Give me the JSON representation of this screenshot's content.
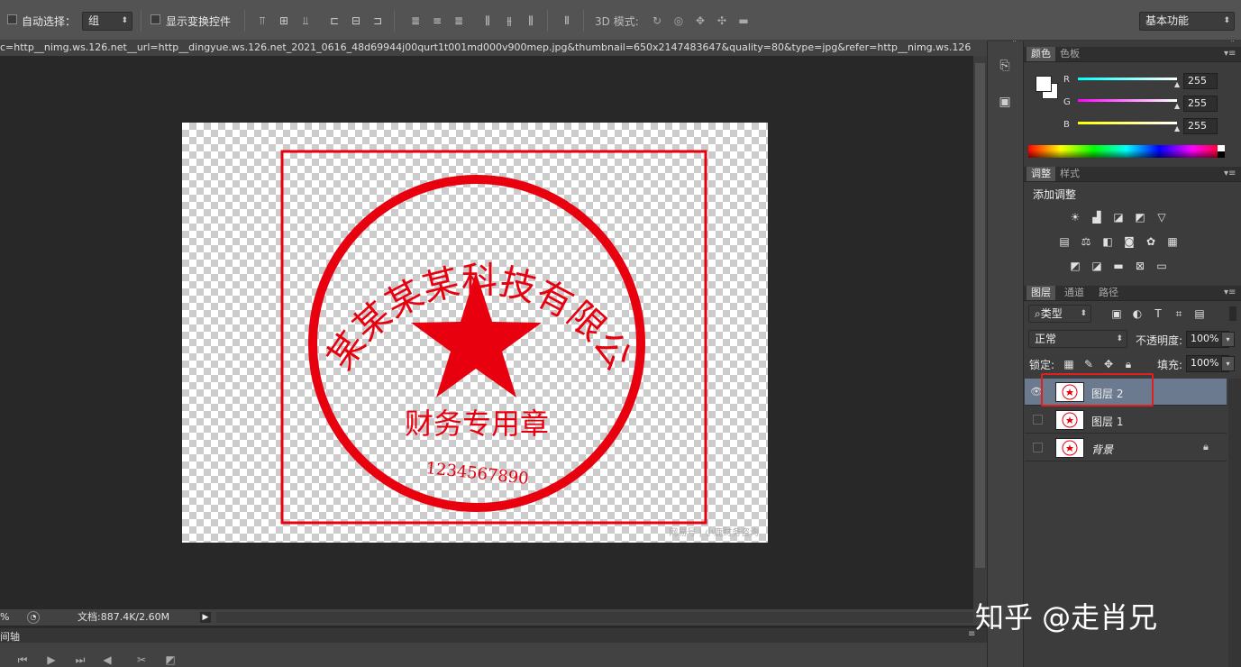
{
  "options_bar": {
    "auto_select_label": "自动选择：",
    "auto_select_value": "组",
    "show_transform_label": "显示变换控件",
    "mode_3d_label": "3D 模式:",
    "workspace_value": "基本功能"
  },
  "document": {
    "tab_title": "c=http__nimg.ws.126.net__url=http__dingyue.ws.126.net_2021_0616_48d69944j00qurt1t001md000v900mep.jpg&thumbnail=650x2147483647&quality=80&type=jpg&refer=http__nimg.ws.126",
    "stamp_arc_text": "某某某某某科技有限公司",
    "stamp_purpose_text": "财务专用章",
    "stamp_number_text": "1234567890",
    "image_watermark": "网易号 | 小鹿财务咨询"
  },
  "status_bar": {
    "zoom": "%",
    "doc_size": "文档:887.4K/2.60M"
  },
  "timeline": {
    "title": "间轴"
  },
  "color_panel": {
    "tabs": [
      "颜色",
      "色板"
    ],
    "r_label": "R",
    "g_label": "G",
    "b_label": "B",
    "r_value": "255",
    "g_value": "255",
    "b_value": "255"
  },
  "adjust_panel": {
    "tabs": [
      "调整",
      "样式"
    ],
    "title": "添加调整"
  },
  "layers_panel": {
    "tabs": [
      "图层",
      "通道",
      "路径"
    ],
    "filter_kind": "类型",
    "blend_mode": "正常",
    "opacity_label": "不透明度:",
    "opacity_value": "100%",
    "lock_label": "锁定:",
    "fill_label": "填充:",
    "fill_value": "100%",
    "layers": [
      {
        "name": "图层 2"
      },
      {
        "name": "图层 1"
      },
      {
        "name": "背景"
      }
    ]
  },
  "watermark": "知乎 @走肖兄",
  "colors": {
    "stamp_red": "#e8000f",
    "selection_outline": "#e02020",
    "selected_layer": "#6b7a8f"
  }
}
